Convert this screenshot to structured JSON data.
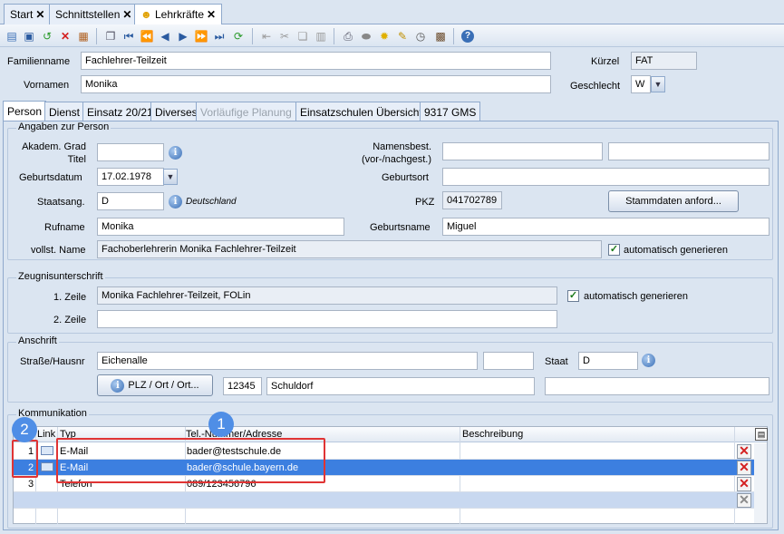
{
  "doc_tabs": [
    {
      "label": "Start",
      "close": "✕"
    },
    {
      "label": "Schnittstellen",
      "close": "✕"
    },
    {
      "label": "Lehrkräfte",
      "close": "✕"
    }
  ],
  "header": {
    "familienname_label": "Familienname",
    "familienname_value": "Fachlehrer-Teilzeit",
    "vornamen_label": "Vornamen",
    "vornamen_value": "Monika",
    "kuerzel_label": "Kürzel",
    "kuerzel_value": "FAT",
    "geschlecht_label": "Geschlecht",
    "geschlecht_value": "W"
  },
  "inner_tabs": [
    "Person",
    "Dienst",
    "Einsatz 20/21",
    "Diverses",
    "Vorläufige Planung",
    "Einsatzschulen Übersicht",
    "9317 GMS"
  ],
  "person": {
    "group_title": "Angaben zur Person",
    "akad_label_1": "Akadem. Grad",
    "akad_label_2": "Titel",
    "akad_value": "",
    "namensbest_label_1": "Namensbest.",
    "namensbest_label_2": "(vor-/nachgest.)",
    "geburtsdatum_label": "Geburtsdatum",
    "geburtsdatum_value": "17.02.1978",
    "geburtsort_label": "Geburtsort",
    "staatsang_label": "Staatsang.",
    "staatsang_value": "D",
    "staatsang_hint": "Deutschland",
    "pkz_label": "PKZ",
    "pkz_value": "041702789",
    "stammdaten_button": "Stammdaten anford...",
    "rufname_label": "Rufname",
    "rufname_value": "Monika",
    "geburtsname_label": "Geburtsname",
    "geburtsname_value": "Miguel",
    "vollst_label": "vollst. Name",
    "vollst_value": "Fachoberlehrerin Monika Fachlehrer-Teilzeit",
    "auto_label": "automatisch generieren"
  },
  "zeugnis": {
    "group_title": "Zeugnisunterschrift",
    "zeile1_label": "1. Zeile",
    "zeile1_value": "Monika Fachlehrer-Teilzeit, FOLin",
    "zeile2_label": "2. Zeile",
    "zeile2_value": "",
    "auto_label": "automatisch generieren"
  },
  "anschrift": {
    "group_title": "Anschrift",
    "strasse_label": "Straße/Hausnr",
    "strasse_value": "Eichenalle",
    "staat_label": "Staat",
    "staat_value": "D",
    "plz_button": "PLZ / Ort / Ort...",
    "plz_value": "12345",
    "ort_value": "Schuldorf"
  },
  "kommunikation": {
    "group_title": "Kommunikation",
    "columns": [
      "Link",
      "Typ",
      "Tel.-Nummer/Adresse",
      "Beschreibung"
    ],
    "rows": [
      {
        "num": "1",
        "typ": "E-Mail",
        "adresse": "bader@testschule.de",
        "beschreibung": ""
      },
      {
        "num": "2",
        "typ": "E-Mail",
        "adresse": "bader@schule.bayern.de",
        "beschreibung": ""
      },
      {
        "num": "3",
        "typ": "Telefon",
        "adresse": "089/123456796",
        "beschreibung": ""
      }
    ]
  },
  "callouts": {
    "badge1": "1",
    "badge2": "2"
  },
  "colors": {
    "accent": "#3c7fe0",
    "callout": "#e03434",
    "badge": "#4f8ee6",
    "background": "#dbe5f1"
  }
}
